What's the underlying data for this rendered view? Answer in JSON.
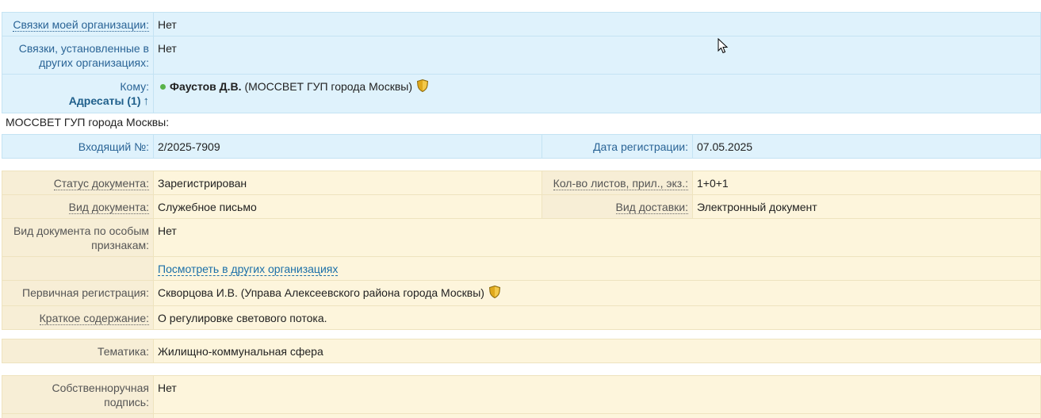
{
  "links": {
    "my_org_label": "Связки моей организации:",
    "my_org_value": "Нет",
    "other_org_label": "Связки, установленные в других организациях:",
    "other_org_value": "Нет",
    "to_label": "Кому:",
    "addressees_label": "Адресаты (1)",
    "addressee_name": "Фаустов Д.В.",
    "addressee_org": "(МОССВЕТ ГУП города Москвы)"
  },
  "org_heading": "МОССВЕТ ГУП города Москвы:",
  "registration": {
    "incoming_label": "Входящий №:",
    "incoming_value": "2/2025-7909",
    "date_label": "Дата регистрации:",
    "date_value": "07.05.2025"
  },
  "document": {
    "status_label": "Статус документа:",
    "status_value": "Зарегистрирован",
    "sheets_label": "Кол-во листов, прил., экз.:",
    "sheets_value": "1+0+1",
    "type_label": "Вид документа:",
    "type_value": "Служебное письмо",
    "delivery_label": "Вид доставки:",
    "delivery_value": "Электронный документ",
    "special_label": "Вид документа по особым признакам:",
    "special_value": "Нет",
    "view_other_link": "Посмотреть в других организациях",
    "primary_label": "Первичная регистрация:",
    "primary_value": "Скворцова И.В. (Управа Алексеевского района города Москвы)",
    "summary_label": "Краткое содержание:",
    "summary_value": "О регулировке светового потока."
  },
  "topic": {
    "label": "Тематика:",
    "value": "Жилищно-коммунальная сфера"
  },
  "signature": {
    "label": "Собственноручная подпись:",
    "value": "Нет"
  },
  "colors": {
    "blue_bg": "#dff2fc",
    "yellow_bg": "#fdf5dc",
    "link": "#1a6fa8",
    "status_dot": "#59b34a",
    "shield": "#d4a017"
  },
  "icons": [
    "status-dot-icon",
    "shield-icon",
    "arrow-up-icon",
    "mouse-cursor-icon"
  ]
}
